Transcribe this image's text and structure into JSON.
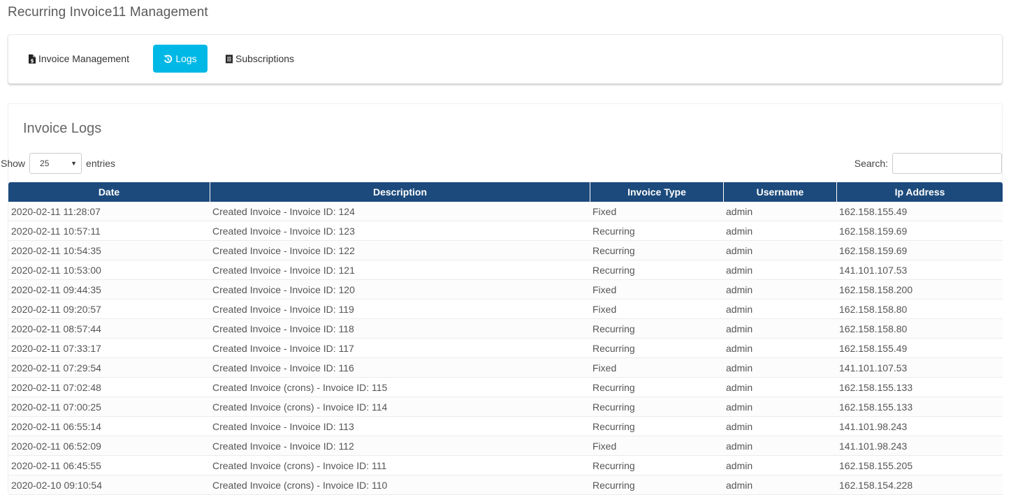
{
  "page": {
    "title": "Recurring Invoice11 Management"
  },
  "tabs": [
    {
      "label": "Invoice Management",
      "icon": "file-invoice-dollar-icon",
      "active": false
    },
    {
      "label": "Logs",
      "icon": "history-icon",
      "active": true
    },
    {
      "label": "Subscriptions",
      "icon": "receipt-icon",
      "active": false
    }
  ],
  "colors": {
    "active_tab": "#00b8e6",
    "table_header": "#1c4a7c"
  },
  "logs": {
    "title": "Invoice Logs",
    "show_label": "Show",
    "entries_label": "entries",
    "page_length": "25",
    "search_label": "Search:",
    "search_value": "",
    "columns": [
      "Date",
      "Description",
      "Invoice Type",
      "Username",
      "Ip Address"
    ],
    "rows": [
      [
        "2020-02-11 11:28:07",
        "Created Invoice - Invoice ID: 124",
        "Fixed",
        "admin",
        "162.158.155.49"
      ],
      [
        "2020-02-11 10:57:11",
        "Created Invoice - Invoice ID: 123",
        "Recurring",
        "admin",
        "162.158.159.69"
      ],
      [
        "2020-02-11 10:54:35",
        "Created Invoice - Invoice ID: 122",
        "Recurring",
        "admin",
        "162.158.159.69"
      ],
      [
        "2020-02-11 10:53:00",
        "Created Invoice - Invoice ID: 121",
        "Recurring",
        "admin",
        "141.101.107.53"
      ],
      [
        "2020-02-11 09:44:35",
        "Created Invoice - Invoice ID: 120",
        "Fixed",
        "admin",
        "162.158.158.200"
      ],
      [
        "2020-02-11 09:20:57",
        "Created Invoice - Invoice ID: 119",
        "Fixed",
        "admin",
        "162.158.158.80"
      ],
      [
        "2020-02-11 08:57:44",
        "Created Invoice - Invoice ID: 118",
        "Recurring",
        "admin",
        "162.158.158.80"
      ],
      [
        "2020-02-11 07:33:17",
        "Created Invoice - Invoice ID: 117",
        "Recurring",
        "admin",
        "162.158.155.49"
      ],
      [
        "2020-02-11 07:29:54",
        "Created Invoice - Invoice ID: 116",
        "Fixed",
        "admin",
        "141.101.107.53"
      ],
      [
        "2020-02-11 07:02:48",
        "Created Invoice (crons) - Invoice ID: 115",
        "Recurring",
        "admin",
        "162.158.155.133"
      ],
      [
        "2020-02-11 07:00:25",
        "Created Invoice (crons) - Invoice ID: 114",
        "Recurring",
        "admin",
        "162.158.155.133"
      ],
      [
        "2020-02-11 06:55:14",
        "Created Invoice - Invoice ID: 113",
        "Recurring",
        "admin",
        "141.101.98.243"
      ],
      [
        "2020-02-11 06:52:09",
        "Created Invoice - Invoice ID: 112",
        "Fixed",
        "admin",
        "141.101.98.243"
      ],
      [
        "2020-02-11 06:45:55",
        "Created Invoice (crons) - Invoice ID: 111",
        "Recurring",
        "admin",
        "162.158.155.205"
      ],
      [
        "2020-02-10 09:10:54",
        "Created Invoice (crons) - Invoice ID: 110",
        "Recurring",
        "admin",
        "162.158.154.228"
      ]
    ]
  }
}
